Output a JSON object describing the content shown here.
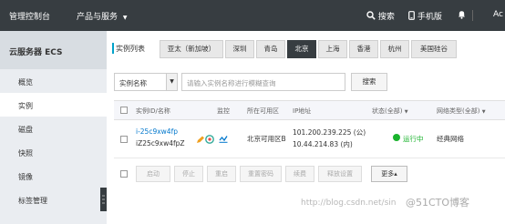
{
  "topbar": {
    "console": "管理控制台",
    "products": "产品与服务",
    "products_chevron": "▼",
    "search": "搜索",
    "mobile": "手机版",
    "user_partial": "Ac"
  },
  "sidebar": {
    "title": "云服务器 ECS",
    "items": [
      "概览",
      "实例",
      "磁盘",
      "快照",
      "镜像",
      "标签管理"
    ]
  },
  "regions": {
    "label": "实例列表",
    "tabs": [
      "亚太（新加坡）",
      "深圳",
      "青岛",
      "北京",
      "上海",
      "香港",
      "杭州",
      "美国硅谷"
    ],
    "active": "北京"
  },
  "filter": {
    "select_value": "实例名称",
    "search_placeholder": "请输入实例名称进行模糊查询",
    "search_button": "搜索"
  },
  "table": {
    "headers": {
      "id_name": "实例ID/名称",
      "monitor": "监控",
      "zone": "所在可用区",
      "ip": "IP地址",
      "status": "状态(全部)",
      "network": "网络类型(全部)"
    },
    "rows": [
      {
        "id": "i-25c9xw4fp",
        "name": "iZ25c9xw4fpZ",
        "zone": "北京可用区B",
        "ip_public": "101.200.239.225 (公)",
        "ip_private": "10.44.214.83 (内)",
        "status": "运行中",
        "network": "经典网络"
      }
    ]
  },
  "actions": [
    "启动",
    "停止",
    "重启",
    "重置密码",
    "续费",
    "释放设置",
    "更多▴"
  ],
  "watermark": {
    "url": "http://blog.csdn.net/sin",
    "brand": "@51CTO博客"
  },
  "colors": {
    "topbar": "#373d41",
    "sidebar": "#eaedf1",
    "link": "#0077cc",
    "running": "#1ab32d"
  }
}
